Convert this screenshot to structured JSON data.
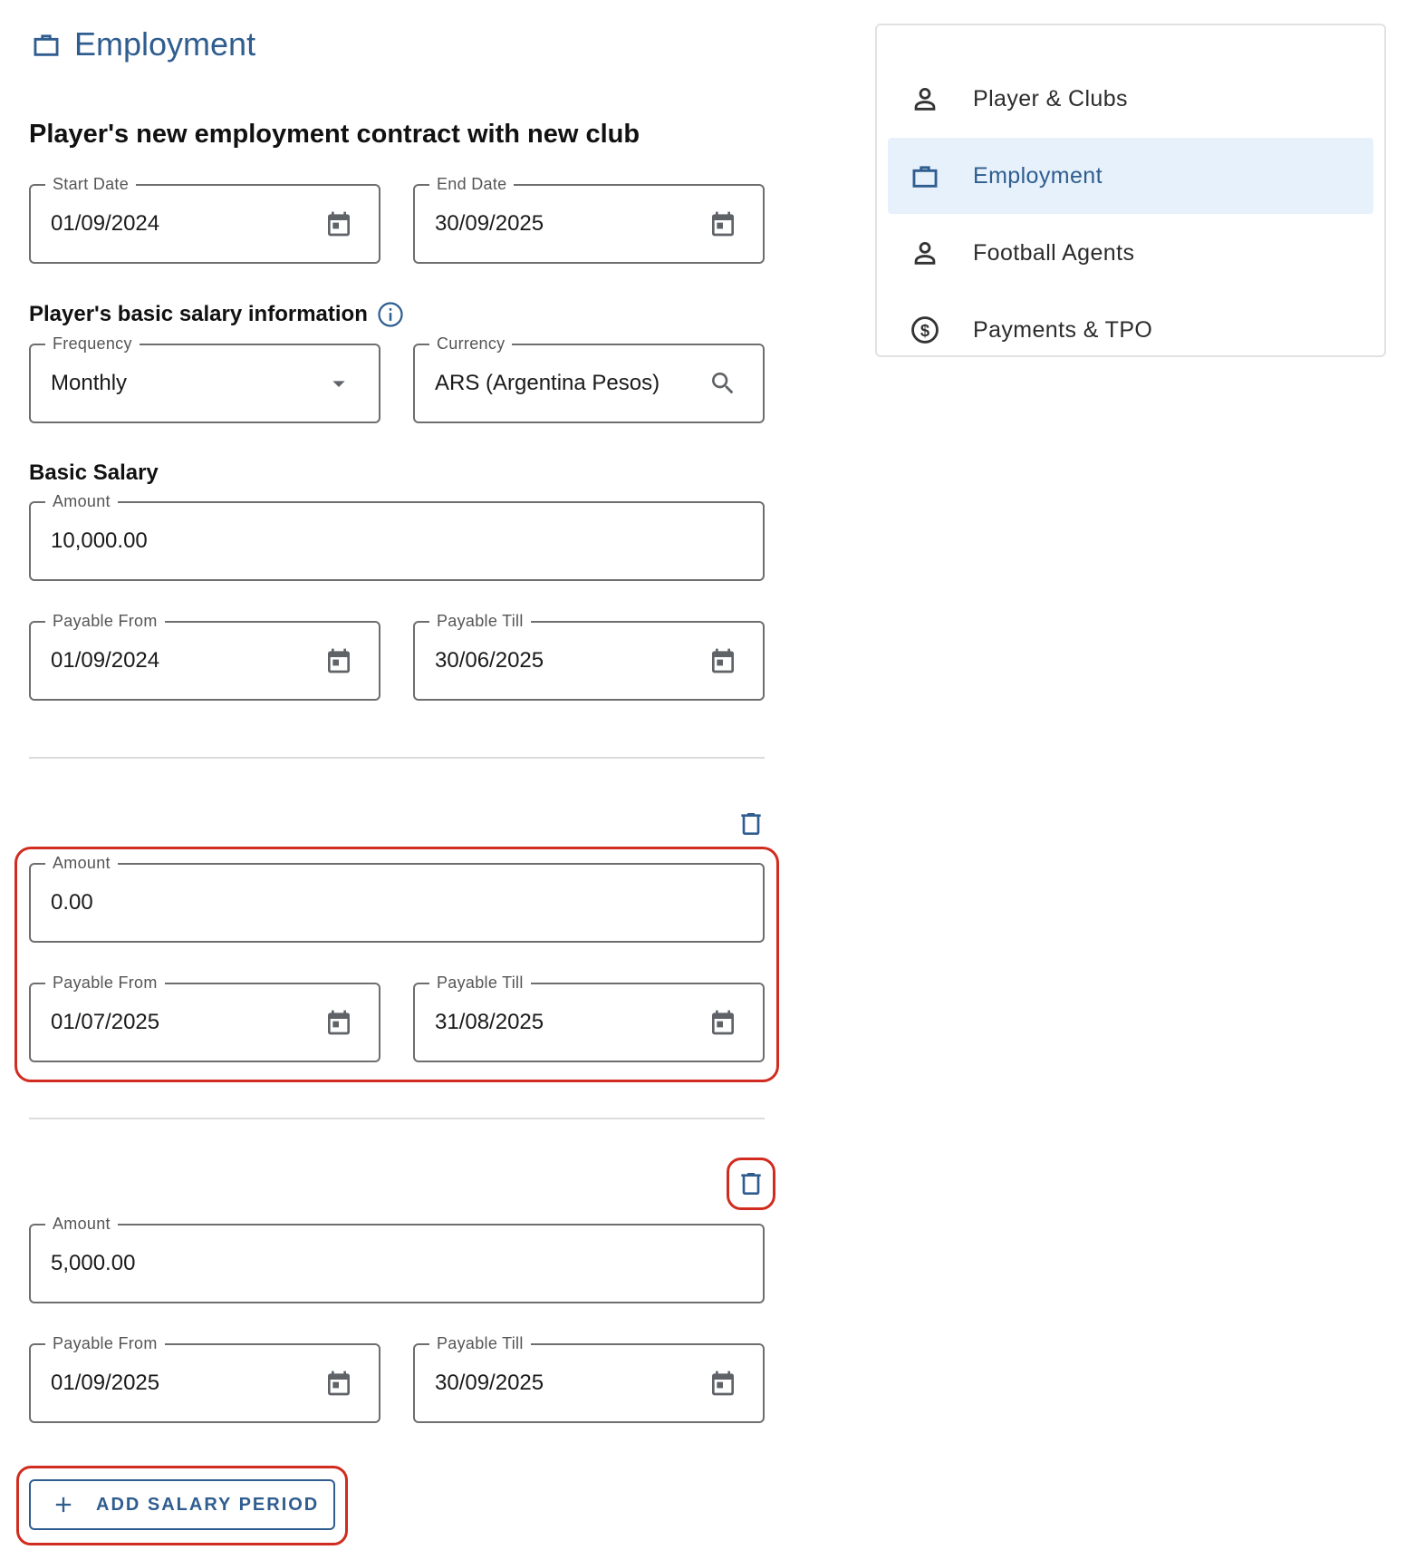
{
  "header": {
    "title": "Employment"
  },
  "contract": {
    "heading": "Player's new employment contract with new club",
    "start_date": {
      "label": "Start Date",
      "value": "01/09/2024"
    },
    "end_date": {
      "label": "End Date",
      "value": "30/09/2025"
    }
  },
  "salary_info": {
    "heading": "Player's basic salary information",
    "frequency": {
      "label": "Frequency",
      "value": "Monthly"
    },
    "currency": {
      "label": "Currency",
      "value": "ARS (Argentina Pesos)"
    }
  },
  "basic_salary": {
    "heading": "Basic Salary",
    "periods": [
      {
        "amount": {
          "label": "Amount",
          "value": "10,000.00"
        },
        "from": {
          "label": "Payable From",
          "value": "01/09/2024"
        },
        "till": {
          "label": "Payable Till",
          "value": "30/06/2025"
        }
      },
      {
        "amount": {
          "label": "Amount",
          "value": "0.00"
        },
        "from": {
          "label": "Payable From",
          "value": "01/07/2025"
        },
        "till": {
          "label": "Payable Till",
          "value": "31/08/2025"
        }
      },
      {
        "amount": {
          "label": "Amount",
          "value": "5,000.00"
        },
        "from": {
          "label": "Payable From",
          "value": "01/09/2025"
        },
        "till": {
          "label": "Payable Till",
          "value": "30/09/2025"
        }
      }
    ],
    "add_button": "ADD SALARY PERIOD"
  },
  "sidebar": {
    "items": [
      {
        "label": "Player & Clubs",
        "icon": "person-icon",
        "active": false
      },
      {
        "label": "Employment",
        "icon": "briefcase-icon",
        "active": true
      },
      {
        "label": "Football Agents",
        "icon": "person-icon",
        "active": false
      },
      {
        "label": "Payments & TPO",
        "icon": "dollar-circle-icon",
        "active": false
      }
    ]
  },
  "colors": {
    "accent": "#2f5d8f",
    "active_bg": "#e6f1fb",
    "highlight": "#d02c1f",
    "border": "#6e6e6e"
  }
}
